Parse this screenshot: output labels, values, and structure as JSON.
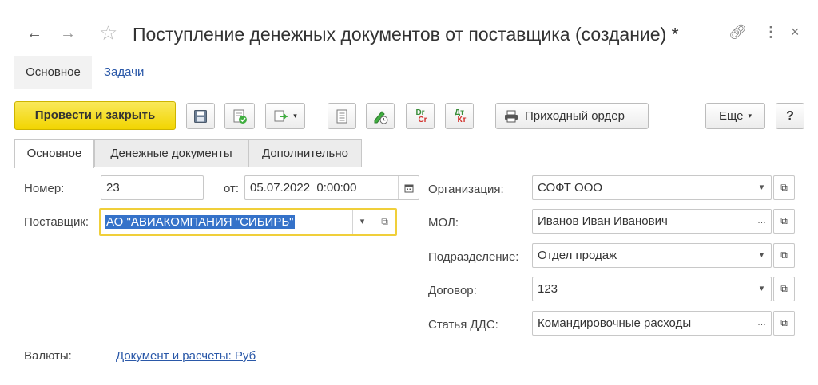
{
  "window": {
    "title": "Поступление денежных документов от поставщика (создание) *"
  },
  "top_tabs": {
    "main": "Основное",
    "tasks": "Задачи"
  },
  "toolbar": {
    "post_close": "Провести и закрыть",
    "dr_cr_top": "Dr",
    "dr_cr_bottom": "Cr",
    "dt_kt_top": "Дт",
    "dt_kt_bottom": "Кт",
    "receipt_order": "Приходный ордер",
    "more": "Еще",
    "help": "?"
  },
  "form_tabs": [
    "Основное",
    "Денежные документы",
    "Дополнительно"
  ],
  "form": {
    "number_label": "Номер:",
    "number_value": "23",
    "date_label": "от:",
    "date_value": "05.07.2022  0:00:00",
    "supplier_label": "Поставщик:",
    "supplier_value": "АО \"АВИАКОМПАНИЯ \"СИБИРЬ\"",
    "org_label": "Организация:",
    "org_value": "СОФТ ООО",
    "mol_label": "МОЛ:",
    "mol_value": "Иванов Иван Иванович",
    "dept_label": "Подразделение:",
    "dept_value": "Отдел продаж",
    "contract_label": "Договор:",
    "contract_value": "123",
    "dds_label": "Статья ДДС:",
    "dds_value": "Командировочные расходы",
    "currency_label": "Валюты:",
    "currency_link": "Документ и расчеты: Руб"
  }
}
